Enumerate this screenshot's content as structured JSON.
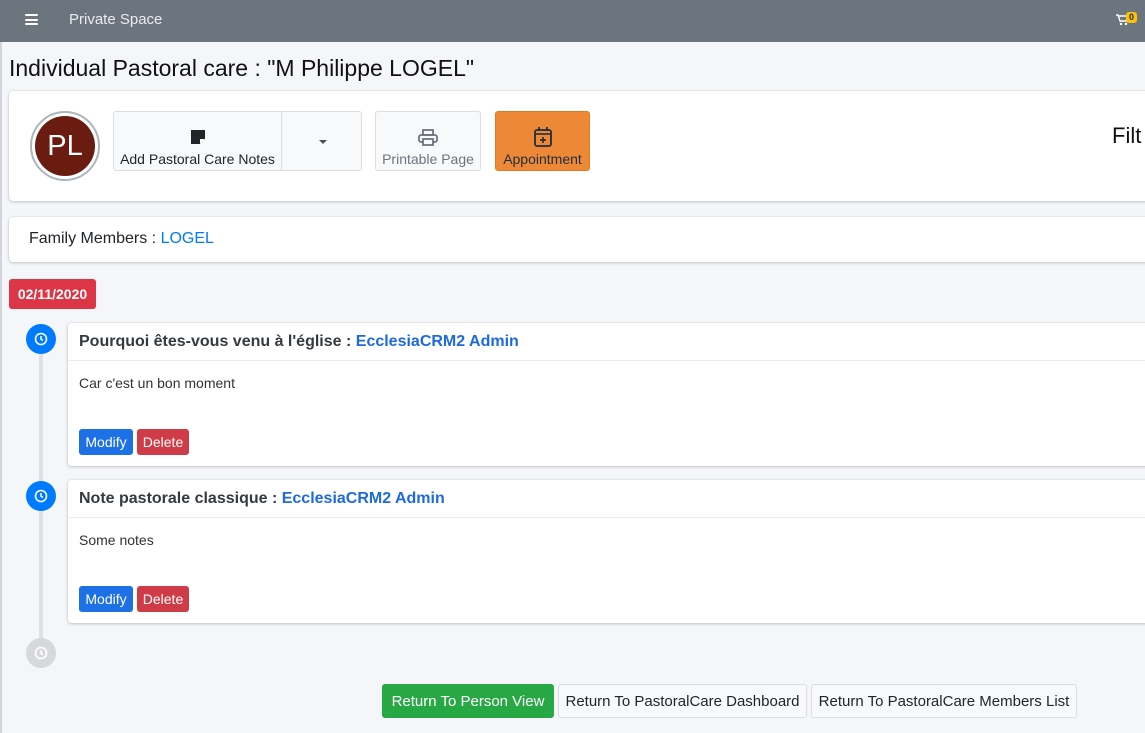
{
  "topbar": {
    "brand": "Private Space",
    "cart_count": "0"
  },
  "page": {
    "title": "Individual Pastoral care : \"M Philippe LOGEL\""
  },
  "profile": {
    "initials": "PL"
  },
  "toolbar": {
    "add_notes_label": "Add Pastoral Care Notes",
    "printable_label": "Printable Page",
    "appointment_label": "Appointment",
    "filter_label": "Filt"
  },
  "family": {
    "label": "Family Members : ",
    "link": "LOGEL"
  },
  "timeline": {
    "date": "02/11/2020",
    "notes": [
      {
        "title": "Pourquoi êtes-vous venu à l'église",
        "separator": " : ",
        "author": "EcclesiaCRM2 Admin",
        "body": "Car c'est un bon moment",
        "modify_label": "Modify",
        "delete_label": "Delete"
      },
      {
        "title": "Note pastorale classique",
        "separator": " : ",
        "author": "EcclesiaCRM2 Admin",
        "body": "Some notes",
        "modify_label": "Modify",
        "delete_label": "Delete"
      }
    ]
  },
  "footer": {
    "return_person": "Return To Person View",
    "return_dashboard": "Return To PastoralCare Dashboard",
    "return_members": "Return To PastoralCare Members List"
  },
  "colors": {
    "topbar": "#6c757d",
    "primary": "#007bff",
    "danger": "#dc3545",
    "success": "#28a745",
    "warning": "#ed8936"
  },
  "icons": {
    "menu": "hamburger-menu-icon",
    "cart": "shopping-cart-icon",
    "note": "sticky-note-icon",
    "caret": "caret-down-icon",
    "print": "printer-icon",
    "calendar": "calendar-plus-icon",
    "clock": "clock-icon"
  }
}
